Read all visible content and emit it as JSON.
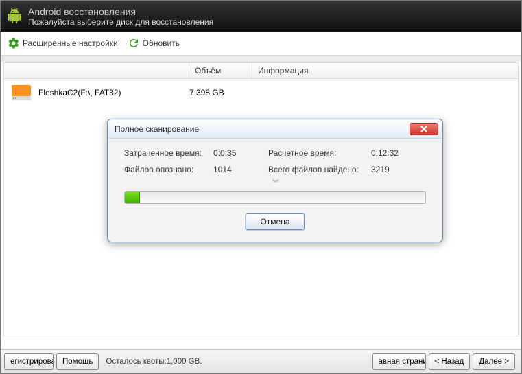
{
  "header": {
    "title": "Android восстановления",
    "subtitle": "Пожалуйста выберите диск для восстановления"
  },
  "toolbar": {
    "advanced": "Расширенные настройки",
    "refresh": "Обновить"
  },
  "columns": {
    "name": "",
    "vol": "Объём",
    "info": "Информация"
  },
  "drives": {
    "row0": {
      "name": "FleshkaC2(F:\\, FAT32)",
      "vol": "7,398 GB"
    }
  },
  "modal": {
    "title": "Полное сканирование",
    "elapsed_l": "Затраченное время:",
    "elapsed_v": "0:0:35",
    "estimated_l": "Расчетное время:",
    "estimated_v": "0:12:32",
    "recognized_l": "Файлов опознано:",
    "recognized_v": "1014",
    "found_l": "Всего файлов найдено:",
    "found_v": "3219",
    "cancel": "Отмена"
  },
  "footer": {
    "register": "егистрирова",
    "help": "Помощь",
    "quota": "Осталось квоты:1,000 GB.",
    "mainpage": "авная страни",
    "back": "< Назад",
    "next": "Далее >"
  }
}
